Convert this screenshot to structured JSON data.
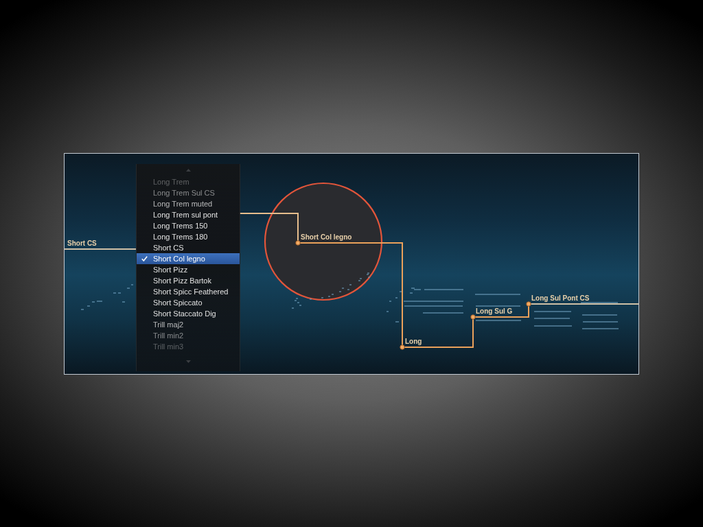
{
  "articulation_map": {
    "nodes": [
      {
        "label": "Short CS",
        "kind": "edge",
        "active": false,
        "highlighted": false
      },
      {
        "label": "Short Col legno",
        "kind": "point",
        "active": true,
        "highlighted": true
      },
      {
        "label": "Long",
        "kind": "point",
        "active": true,
        "highlighted": false
      },
      {
        "label": "Long Sul G",
        "kind": "point",
        "active": true,
        "highlighted": false
      },
      {
        "label": "Long Sul Pont CS",
        "kind": "point",
        "active": false,
        "highlighted": false
      }
    ]
  },
  "menu": {
    "items": [
      {
        "label": "Long Trem",
        "selected": false
      },
      {
        "label": "Long Trem Sul CS",
        "selected": false
      },
      {
        "label": "Long Trem muted",
        "selected": false
      },
      {
        "label": "Long Trem sul pont",
        "selected": false
      },
      {
        "label": "Long Trems 150",
        "selected": false
      },
      {
        "label": "Long Trems 180",
        "selected": false
      },
      {
        "label": "Short CS",
        "selected": false
      },
      {
        "label": "Short Col legno",
        "selected": true
      },
      {
        "label": "Short Pizz",
        "selected": false
      },
      {
        "label": "Short Pizz Bartok",
        "selected": false
      },
      {
        "label": "Short Spicc Feathered",
        "selected": false
      },
      {
        "label": "Short Spiccato",
        "selected": false
      },
      {
        "label": "Short Staccato Dig",
        "selected": false
      },
      {
        "label": "Trill maj2",
        "selected": false
      },
      {
        "label": "Trill min2",
        "selected": false
      },
      {
        "label": "Trill min3",
        "selected": false
      }
    ]
  }
}
